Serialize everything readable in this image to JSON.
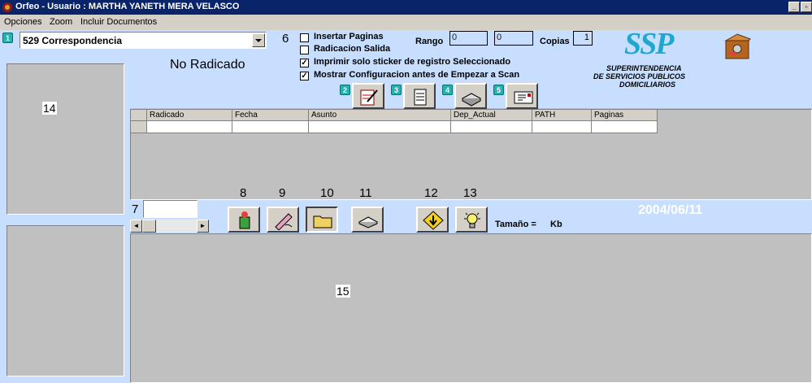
{
  "window": {
    "title": "Orfeo - Usuario : MARTHA YANETH MERA VELASCO"
  },
  "menu": {
    "items": [
      "Opciones",
      "Zoom",
      "Incluir Documentos"
    ]
  },
  "dependency": {
    "selected": "529 Correspondencia"
  },
  "status": {
    "radicado_text": "No Radicado"
  },
  "options": {
    "insertar_paginas": "Insertar Paginas",
    "radicacion_salida": "Radicacion Salida",
    "imprimir_sticker": "Imprimir solo sticker de registro Seleccionado",
    "mostrar_config": "Mostrar Configuracion antes de Empezar a Scan",
    "insertar_checked": false,
    "salida_checked": false,
    "imprimir_checked": true,
    "mostrar_checked": true
  },
  "range": {
    "label": "Rango",
    "from": "0",
    "to": "0"
  },
  "copies": {
    "label": "Copias",
    "value": "1"
  },
  "logo": {
    "text": "SSP",
    "line1": "SUPERINTENDENCIA",
    "line2": "DE SERVICIOS PUBLICOS",
    "line3": "DOMICILIARIOS"
  },
  "badges": {
    "b1": "1",
    "b2": "2",
    "b3": "3",
    "b4": "4",
    "b5": "5"
  },
  "labels": {
    "n6": "6",
    "n7": "7",
    "n8": "8",
    "n9": "9",
    "n10": "10",
    "n11": "11",
    "n12": "12",
    "n13": "13",
    "n14": "14",
    "n15": "15"
  },
  "table": {
    "columns": [
      "Radicado",
      "Fecha",
      "Asunto",
      "Dep_Actual",
      "PATH",
      "Paginas"
    ]
  },
  "toolbar": {
    "date": "2004/06/11",
    "size_label": "Tamaño =",
    "size_unit": "Kb"
  },
  "colors": {
    "panel_blue": "#c7deff",
    "title_blue": "#0a246a",
    "badge_teal": "#27b0b0"
  }
}
